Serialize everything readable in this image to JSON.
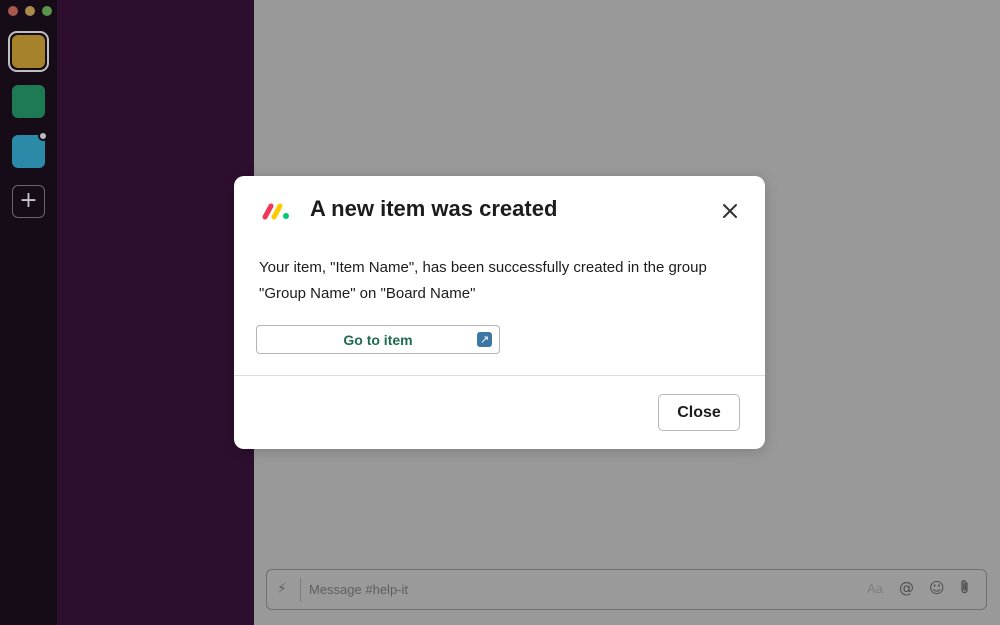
{
  "modal": {
    "title": "A new item was created",
    "body": "Your item, \"Item Name\", has been successfully created in the group \"Group Name\" on \"Board Name\"",
    "go_to_item_label": "Go to item",
    "close_label": "Close",
    "logo_icon": "monday-logo-icon",
    "close_icon": "close-icon",
    "external_icon": "external-link-icon"
  },
  "composer": {
    "placeholder": "Message #help-it",
    "format_label": "Aa",
    "icons": [
      "lightning-icon",
      "mention-icon",
      "emoji-icon",
      "paperclip-icon"
    ]
  },
  "workspaces": {
    "colors": [
      "#a6822a",
      "#1d7a55",
      "#2a8aa8"
    ],
    "add_icon": "plus-icon"
  },
  "colors": {
    "sidebar": "#2d0e2e",
    "rail": "#150c18",
    "accent_green": "#1f6b50"
  }
}
